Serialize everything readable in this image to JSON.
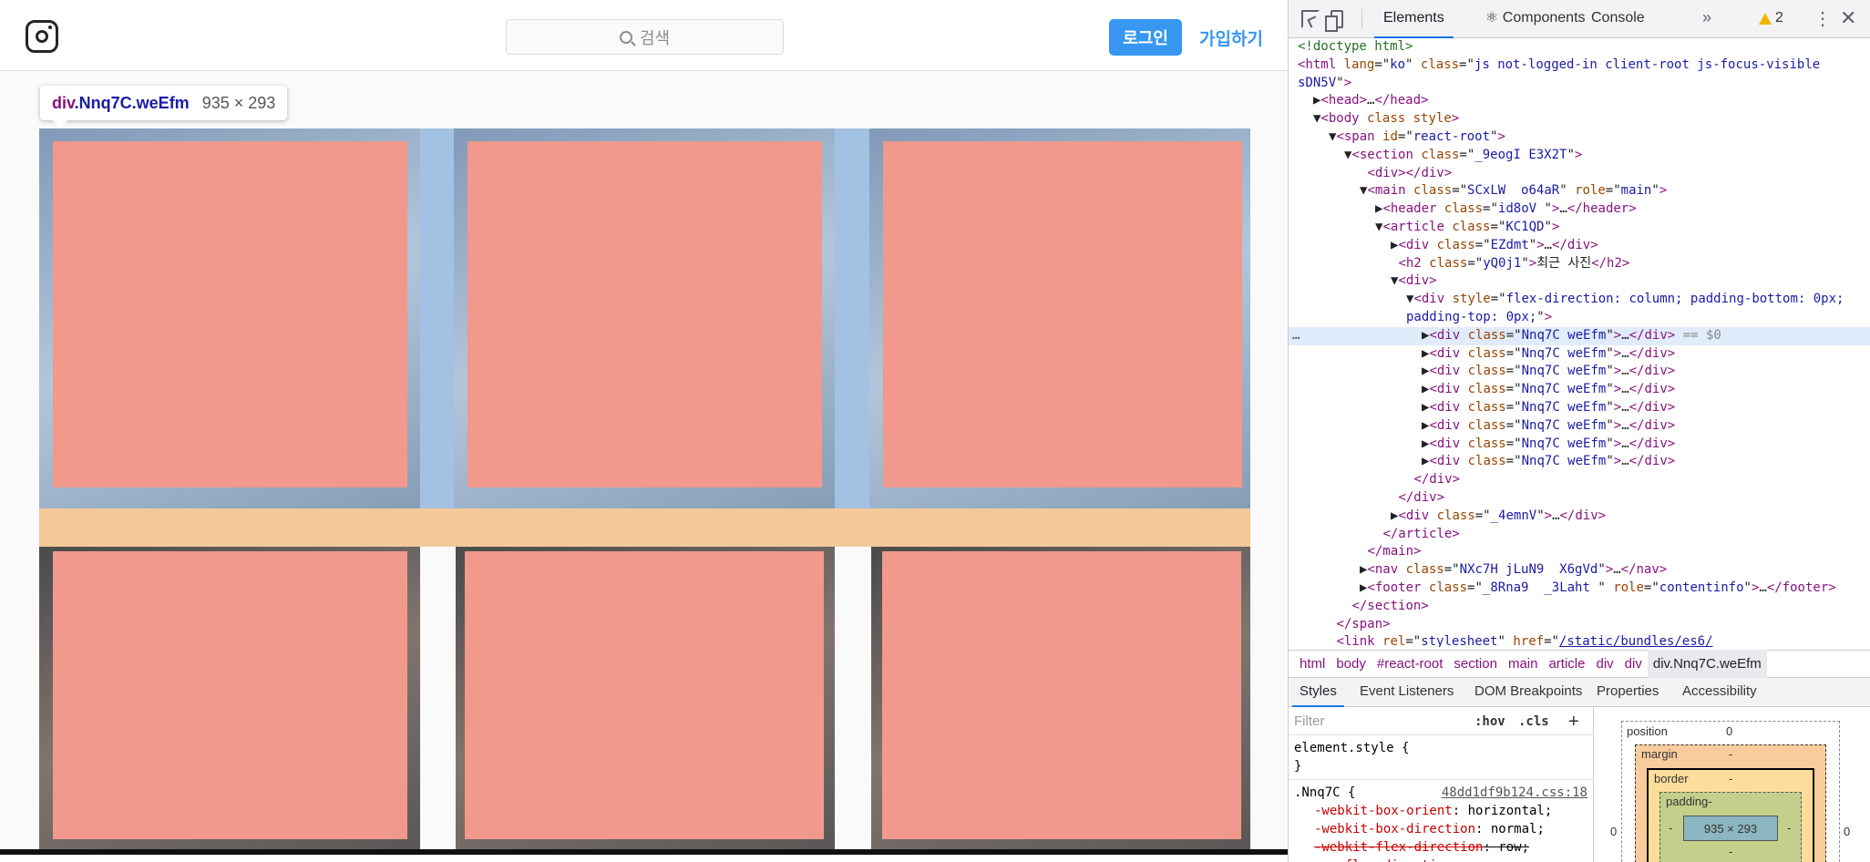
{
  "header": {
    "search_placeholder": "검색",
    "login_label": "로그인",
    "signup_label": "가입하기"
  },
  "tooltip": {
    "tag": "div",
    "class_part": ".Nnq7C.weEfm",
    "size": "935 × 293"
  },
  "devtools": {
    "tabs": [
      "Elements",
      "Components",
      "Console"
    ],
    "warning_count": "2",
    "dom_lines": [
      {
        "indent": 0,
        "html": "<span class='t-com'>&lt;!doctype html&gt;</span>"
      },
      {
        "indent": 0,
        "html": "<span class='t-tag'>&lt;html</span> <span class='t-attr'>lang</span>=\"<span class='t-val'>ko</span>\" <span class='t-attr'>class</span>=\"<span class='t-val'>js not-logged-in client-root js-focus-visible</span>"
      },
      {
        "indent": 0,
        "html": "<span class='t-val'>sDN5V</span>\"<span class='t-tag'>&gt;</span>"
      },
      {
        "indent": 1,
        "html": "▶<span class='t-tag'>&lt;head&gt;</span>…<span class='t-tag'>&lt;/head&gt;</span>"
      },
      {
        "indent": 1,
        "html": "▼<span class='t-tag'>&lt;body</span> <span class='t-attr'>class</span> <span class='t-attr'>style</span><span class='t-tag'>&gt;</span>"
      },
      {
        "indent": 2,
        "html": "▼<span class='t-tag'>&lt;span</span> <span class='t-attr'>id</span>=\"<span class='t-val'>react-root</span>\"<span class='t-tag'>&gt;</span>"
      },
      {
        "indent": 3,
        "html": "▼<span class='t-tag'>&lt;section</span> <span class='t-attr'>class</span>=\"<span class='t-val'>_9eogI E3X2T</span>\"<span class='t-tag'>&gt;</span>"
      },
      {
        "indent": 4,
        "html": " <span class='t-tag'>&lt;div&gt;&lt;/div&gt;</span>"
      },
      {
        "indent": 4,
        "html": "▼<span class='t-tag'>&lt;main</span> <span class='t-attr'>class</span>=\"<span class='t-val'>SCxLW  o64aR</span>\" <span class='t-attr'>role</span>=\"<span class='t-val'>main</span>\"<span class='t-tag'>&gt;</span>"
      },
      {
        "indent": 5,
        "html": "▶<span class='t-tag'>&lt;header</span> <span class='t-attr'>class</span>=\"<span class='t-val'>id8oV </span>\"<span class='t-tag'>&gt;</span>…<span class='t-tag'>&lt;/header&gt;</span>"
      },
      {
        "indent": 5,
        "html": "▼<span class='t-tag'>&lt;article</span> <span class='t-attr'>class</span>=\"<span class='t-val'>KC1QD</span>\"<span class='t-tag'>&gt;</span>"
      },
      {
        "indent": 6,
        "html": "▶<span class='t-tag'>&lt;div</span> <span class='t-attr'>class</span>=\"<span class='t-val'>EZdmt</span>\"<span class='t-tag'>&gt;</span>…<span class='t-tag'>&lt;/div&gt;</span>"
      },
      {
        "indent": 6,
        "html": " <span class='t-tag'>&lt;h2</span> <span class='t-attr'>class</span>=\"<span class='t-val'>yQ0j1</span>\"<span class='t-tag'>&gt;</span>최근 사진<span class='t-tag'>&lt;/h2&gt;</span>"
      },
      {
        "indent": 6,
        "html": "▼<span class='t-tag'>&lt;div&gt;</span>"
      },
      {
        "indent": 7,
        "html": "▼<span class='t-tag'>&lt;div</span> <span class='t-attr'>style</span>=\"<span class='t-val'>flex-direction: column; padding-bottom: 0px;</span>"
      },
      {
        "indent": 7,
        "html": "<span class='t-val'>padding-top: 0px;</span>\"<span class='t-tag'>&gt;</span>"
      },
      {
        "indent": 8,
        "html": "▶<span class='t-tag'>&lt;div</span> <span class='t-attr'>class</span>=\"<span class='t-val'>Nnq7C weEfm</span>\"<span class='t-tag'>&gt;</span>…<span class='t-tag'>&lt;/div&gt;</span> <span class='t-gray'>== $0</span>",
        "selected": true
      },
      {
        "indent": 8,
        "html": "▶<span class='t-tag'>&lt;div</span> <span class='t-attr'>class</span>=\"<span class='t-val'>Nnq7C weEfm</span>\"<span class='t-tag'>&gt;</span>…<span class='t-tag'>&lt;/div&gt;</span>"
      },
      {
        "indent": 8,
        "html": "▶<span class='t-tag'>&lt;div</span> <span class='t-attr'>class</span>=\"<span class='t-val'>Nnq7C weEfm</span>\"<span class='t-tag'>&gt;</span>…<span class='t-tag'>&lt;/div&gt;</span>"
      },
      {
        "indent": 8,
        "html": "▶<span class='t-tag'>&lt;div</span> <span class='t-attr'>class</span>=\"<span class='t-val'>Nnq7C weEfm</span>\"<span class='t-tag'>&gt;</span>…<span class='t-tag'>&lt;/div&gt;</span>"
      },
      {
        "indent": 8,
        "html": "▶<span class='t-tag'>&lt;div</span> <span class='t-attr'>class</span>=\"<span class='t-val'>Nnq7C weEfm</span>\"<span class='t-tag'>&gt;</span>…<span class='t-tag'>&lt;/div&gt;</span>"
      },
      {
        "indent": 8,
        "html": "▶<span class='t-tag'>&lt;div</span> <span class='t-attr'>class</span>=\"<span class='t-val'>Nnq7C weEfm</span>\"<span class='t-tag'>&gt;</span>…<span class='t-tag'>&lt;/div&gt;</span>"
      },
      {
        "indent": 8,
        "html": "▶<span class='t-tag'>&lt;div</span> <span class='t-attr'>class</span>=\"<span class='t-val'>Nnq7C weEfm</span>\"<span class='t-tag'>&gt;</span>…<span class='t-tag'>&lt;/div&gt;</span>"
      },
      {
        "indent": 8,
        "html": "▶<span class='t-tag'>&lt;div</span> <span class='t-attr'>class</span>=\"<span class='t-val'>Nnq7C weEfm</span>\"<span class='t-tag'>&gt;</span>…<span class='t-tag'>&lt;/div&gt;</span>"
      },
      {
        "indent": 7,
        "html": " <span class='t-tag'>&lt;/div&gt;</span>"
      },
      {
        "indent": 6,
        "html": " <span class='t-tag'>&lt;/div&gt;</span>"
      },
      {
        "indent": 6,
        "html": "▶<span class='t-tag'>&lt;div</span> <span class='t-attr'>class</span>=\"<span class='t-val'>_4emnV</span>\"<span class='t-tag'>&gt;</span>…<span class='t-tag'>&lt;/div&gt;</span>"
      },
      {
        "indent": 5,
        "html": " <span class='t-tag'>&lt;/article&gt;</span>"
      },
      {
        "indent": 4,
        "html": " <span class='t-tag'>&lt;/main&gt;</span>"
      },
      {
        "indent": 4,
        "html": "▶<span class='t-tag'>&lt;nav</span> <span class='t-attr'>class</span>=\"<span class='t-val'>NXc7H jLuN9  X6gVd</span>\"<span class='t-tag'>&gt;</span>…<span class='t-tag'>&lt;/nav&gt;</span>"
      },
      {
        "indent": 4,
        "html": "▶<span class='t-tag'>&lt;footer</span> <span class='t-attr'>class</span>=\"<span class='t-val'>_8Rna9  _3Laht </span>\" <span class='t-attr'>role</span>=\"<span class='t-val'>contentinfo</span>\"<span class='t-tag'>&gt;</span>…<span class='t-tag'>&lt;/footer&gt;</span>"
      },
      {
        "indent": 3,
        "html": " <span class='t-tag'>&lt;/section&gt;</span>"
      },
      {
        "indent": 2,
        "html": " <span class='t-tag'>&lt;/span&gt;</span>"
      },
      {
        "indent": 2,
        "html": " <span class='t-tag'>&lt;link</span> <span class='t-attr'>rel</span>=\"<span class='t-val'>stylesheet</span>\" <span class='t-attr'>href</span>=\"<span class='t-link'>/static/bundles/es6/</span>"
      }
    ],
    "breadcrumbs": [
      "html",
      "body",
      "#react-root",
      "section",
      "main",
      "article",
      "div",
      "div",
      "div.Nnq7C.weEfm"
    ],
    "subtabs": [
      "Styles",
      "Event Listeners",
      "DOM Breakpoints",
      "Properties",
      "Accessibility"
    ],
    "styles": {
      "filter_placeholder": "Filter",
      "hov": ":hov",
      "cls": ".cls",
      "element_style": "element.style {",
      "close_brace": "}",
      "rule_selector": ".Nnq7C {",
      "rule_source": "48dd1df9b124.css:18",
      "decls": [
        {
          "name": "-webkit-box-orient",
          "value": "horizontal;",
          "strike": false
        },
        {
          "name": "-webkit-box-direction",
          "value": "normal;",
          "strike": false
        },
        {
          "name": "-webkit-flex-direction",
          "value": "row;",
          "strike": true
        },
        {
          "name": "-ms-flex-direction",
          "value": "row;",
          "strike": false
        }
      ]
    },
    "box_model": {
      "position_label": "position",
      "position_value": "0",
      "margin_label": "margin",
      "margin_value": "-",
      "border_label": "border",
      "border_value": "-",
      "padding_label": "padding-",
      "content_size": "935 × 293",
      "side_value": "0",
      "dash": "-"
    }
  }
}
